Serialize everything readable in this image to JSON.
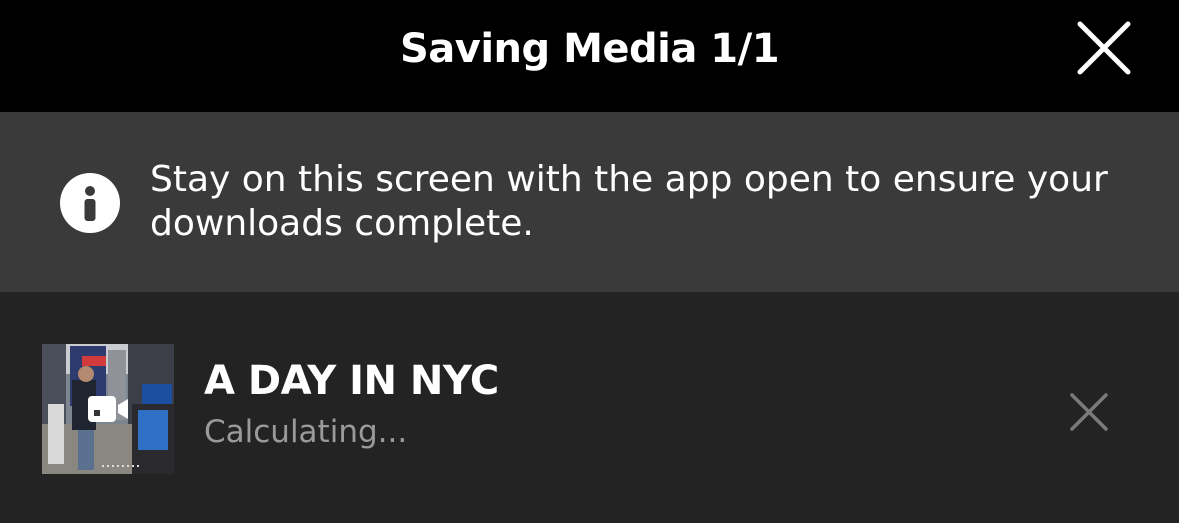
{
  "header": {
    "title": "Saving Media 1/1",
    "close_icon": "close-icon"
  },
  "banner": {
    "icon": "info-icon",
    "message": "Stay on this screen with the app open to ensure your downloads complete."
  },
  "download_item": {
    "title": "A DAY IN NYC",
    "status": "Calculating...",
    "thumbnail_badge_icon": "video-camera-icon",
    "cancel_icon": "close-icon"
  },
  "colors": {
    "header_bg": "#000000",
    "banner_bg": "#3a3a3a",
    "list_bg": "#232323",
    "text_primary": "#ffffff",
    "text_secondary": "#9a9a9a"
  }
}
